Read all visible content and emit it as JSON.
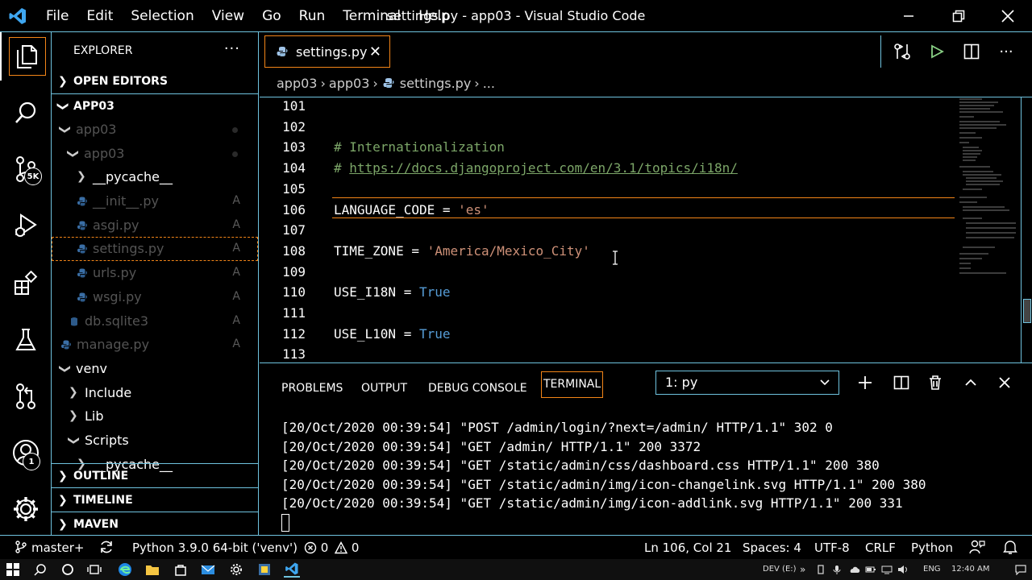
{
  "window": {
    "title": "settings.py - app03 - Visual Studio Code",
    "menu": [
      "File",
      "Edit",
      "Selection",
      "View",
      "Go",
      "Run",
      "Terminal",
      "Help"
    ]
  },
  "activity": {
    "scm_badge": "5K",
    "account_badge": "1"
  },
  "sidebar": {
    "title": "EXPLORER",
    "more": "···",
    "open_editors": "OPEN EDITORS",
    "root": "APP03",
    "tree": [
      {
        "label": "app03",
        "dim": true,
        "status": "dot"
      },
      {
        "label": "app03",
        "dim": true,
        "status": "dot"
      },
      {
        "label": "__pycache__",
        "dim": false,
        "status": ""
      },
      {
        "label": "__init__.py",
        "dim": true,
        "status": "A"
      },
      {
        "label": "asgi.py",
        "dim": true,
        "status": "A"
      },
      {
        "label": "settings.py",
        "dim": true,
        "status": "A"
      },
      {
        "label": "urls.py",
        "dim": true,
        "status": "A"
      },
      {
        "label": "wsgi.py",
        "dim": true,
        "status": "A"
      },
      {
        "label": "db.sqlite3",
        "dim": true,
        "status": "A"
      },
      {
        "label": "manage.py",
        "dim": true,
        "status": "A"
      },
      {
        "label": "venv",
        "dim": false,
        "status": ""
      },
      {
        "label": "Include",
        "dim": false,
        "status": ""
      },
      {
        "label": "Lib",
        "dim": false,
        "status": ""
      },
      {
        "label": "Scripts",
        "dim": false,
        "status": ""
      },
      {
        "label": "__pycache__",
        "dim": false,
        "status": ""
      }
    ],
    "outline": "OUTLINE",
    "timeline": "TIMELINE",
    "maven": "MAVEN"
  },
  "editor": {
    "tab_label": "settings.py",
    "breadcrumbs": [
      "app03",
      "app03",
      "settings.py",
      "..."
    ],
    "lines": [
      {
        "n": "101",
        "parts": []
      },
      {
        "n": "102",
        "parts": []
      },
      {
        "n": "103",
        "parts": [
          {
            "t": "# Internationalization",
            "c": "cm"
          }
        ]
      },
      {
        "n": "104",
        "parts": [
          {
            "t": "# ",
            "c": "cm"
          },
          {
            "t": "https://docs.djangoproject.com/en/3.1/topics/i18n/",
            "c": "link"
          }
        ]
      },
      {
        "n": "105",
        "parts": []
      },
      {
        "n": "106",
        "parts": [
          {
            "t": "LANGUAGE_CODE = ",
            "c": ""
          },
          {
            "t": "'es'",
            "c": "str"
          }
        ]
      },
      {
        "n": "107",
        "parts": []
      },
      {
        "n": "108",
        "parts": [
          {
            "t": "TIME_ZONE = ",
            "c": ""
          },
          {
            "t": "'America/Mexico_City'",
            "c": "str"
          }
        ]
      },
      {
        "n": "109",
        "parts": []
      },
      {
        "n": "110",
        "parts": [
          {
            "t": "USE_I18N = ",
            "c": ""
          },
          {
            "t": "True",
            "c": "kw"
          }
        ]
      },
      {
        "n": "111",
        "parts": []
      },
      {
        "n": "112",
        "parts": [
          {
            "t": "USE_L10N = ",
            "c": ""
          },
          {
            "t": "True",
            "c": "kw"
          }
        ]
      },
      {
        "n": "113",
        "parts": []
      }
    ]
  },
  "panel": {
    "tabs": [
      "PROBLEMS",
      "OUTPUT",
      "DEBUG CONSOLE",
      "TERMINAL"
    ],
    "terminal_select": "1: py",
    "terminal_lines": [
      "[20/Oct/2020 00:39:54] \"POST /admin/login/?next=/admin/ HTTP/1.1\" 302 0",
      "[20/Oct/2020 00:39:54] \"GET /admin/ HTTP/1.1\" 200 3372",
      "[20/Oct/2020 00:39:54] \"GET /static/admin/css/dashboard.css HTTP/1.1\" 200 380",
      "[20/Oct/2020 00:39:54] \"GET /static/admin/img/icon-changelink.svg HTTP/1.1\" 200 380",
      "[20/Oct/2020 00:39:54] \"GET /static/admin/img/icon-addlink.svg HTTP/1.1\" 200 331"
    ]
  },
  "status": {
    "branch": "master+",
    "interpreter": "Python 3.9.0 64-bit ('venv')",
    "errors": "0",
    "warnings": "0",
    "position": "Ln 106, Col 21",
    "spaces": "Spaces: 4",
    "encoding": "UTF-8",
    "eol": "CRLF",
    "language": "Python"
  },
  "taskbar": {
    "drive": "DEV (E:)",
    "lang": "ENG",
    "time": "12:40 AM"
  },
  "colors": {
    "border": "#6fc3df",
    "focus": "#f38518",
    "comment": "#7ca668",
    "string": "#ce9178",
    "keyword": "#569cd6"
  }
}
